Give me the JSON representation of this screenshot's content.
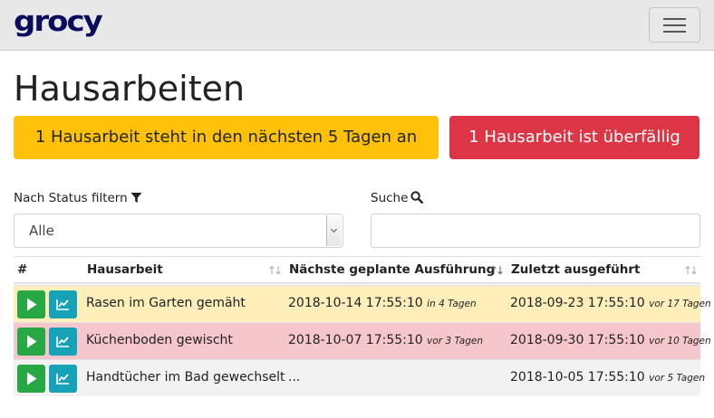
{
  "navbar": {
    "logo_text": "grocy",
    "menu_toggle_icon": "hamburger-menu-icon"
  },
  "page": {
    "title": "Hausarbeiten"
  },
  "alerts": {
    "due_soon": "1 Hausarbeit steht in den nächsten 5 Tagen an",
    "overdue": "1 Hausarbeit ist überfällig"
  },
  "filters": {
    "status_label": "Nach Status filtern",
    "status_icon": "filter-icon",
    "status_value": "Alle",
    "search_label": "Suche",
    "search_icon": "search-icon",
    "search_value": ""
  },
  "table": {
    "headers": [
      "#",
      "Hausarbeit",
      "Nächste geplante Ausführung",
      "Zuletzt ausgeführt"
    ],
    "sort_icon": "sort-icon",
    "action_icons": [
      "play-icon",
      "chart-icon"
    ],
    "rows": [
      {
        "name": "Rasen im Garten gemäht",
        "next_date": "2018-10-14 17:55:10",
        "next_relative": "in 4 Tagen",
        "last_date": "2018-09-23 17:55:10",
        "last_relative": "vor 17 Tagen",
        "status": "due-soon"
      },
      {
        "name": "Küchenboden gewischt",
        "next_date": "2018-10-07 17:55:10",
        "next_relative": "vor 3 Tagen",
        "last_date": "2018-09-30 17:55:10",
        "last_relative": "vor 10 Tagen",
        "status": "overdue"
      },
      {
        "name": "Handtücher im Bad gewechselt",
        "next_date": "...",
        "next_relative": "",
        "last_date": "2018-10-05 17:55:10",
        "last_relative": "vor 5 Tagen",
        "status": "normal"
      }
    ]
  },
  "colors": {
    "warning": "#ffc107",
    "danger": "#dc3545",
    "success": "#28a745",
    "info": "#17a2b8",
    "warning_row": "#feeeba",
    "danger_row": "#f5c6cb"
  }
}
